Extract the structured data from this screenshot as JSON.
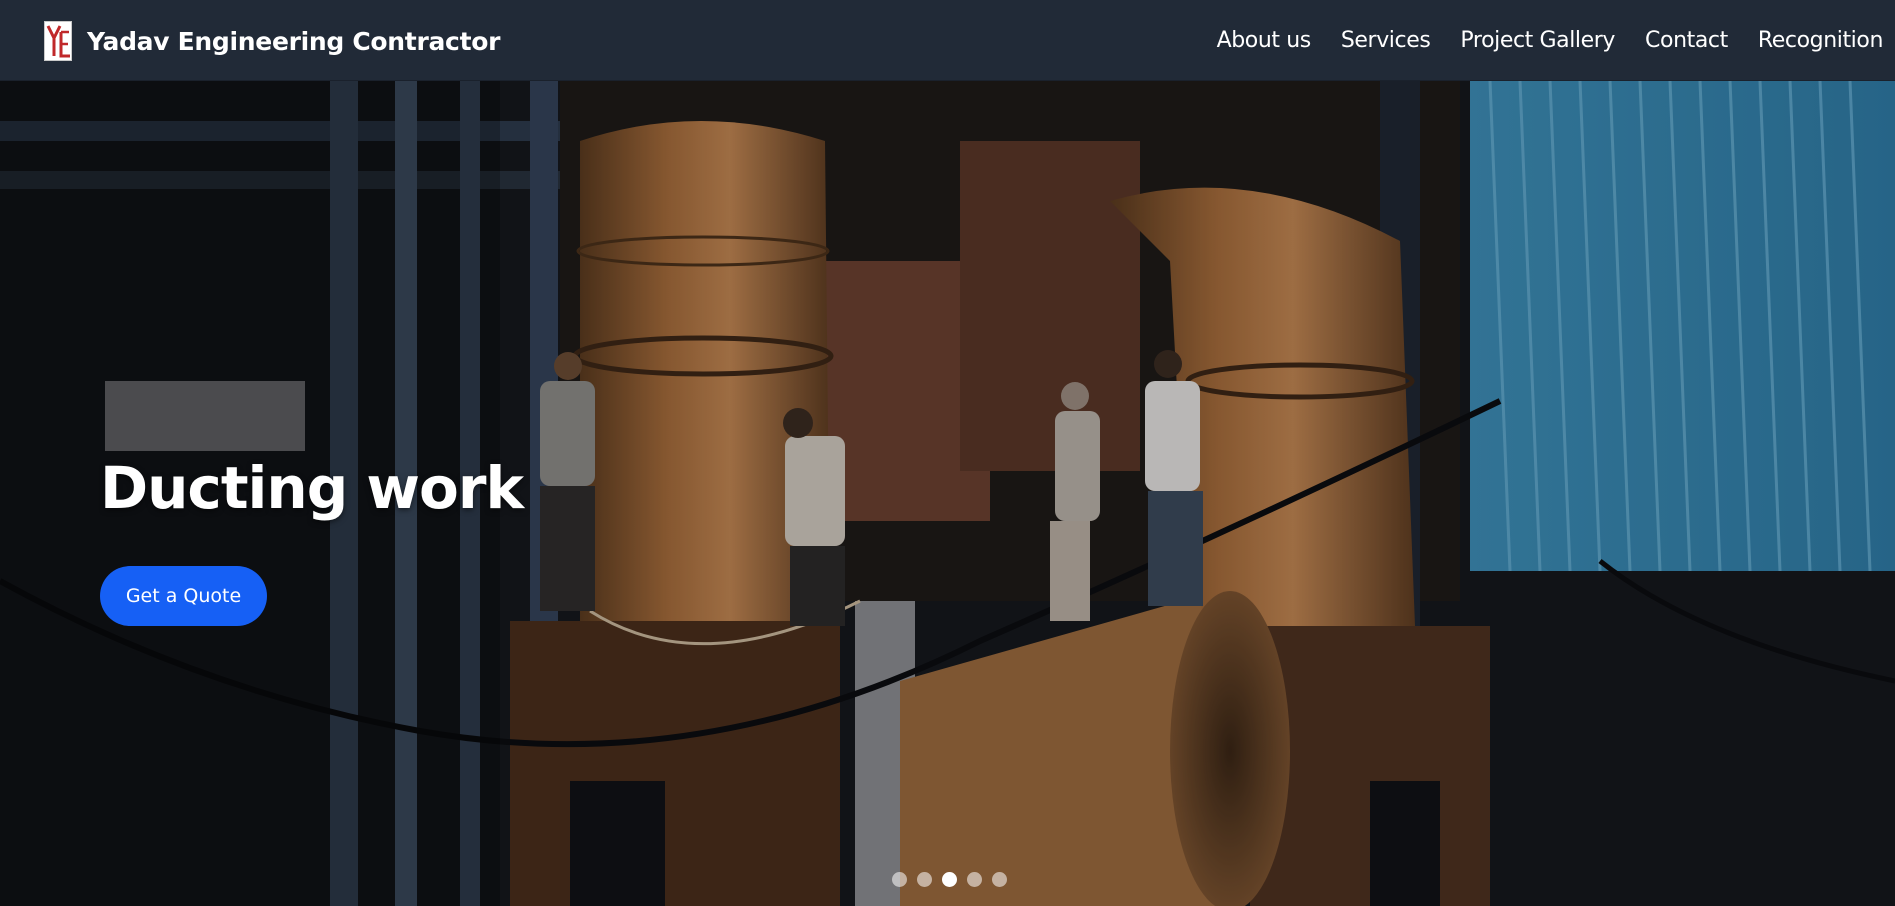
{
  "brand": {
    "name": "Yadav Engineering Contractor",
    "logo_text": "YE",
    "logo_color": "#c0282a"
  },
  "nav": {
    "items": [
      {
        "label": "About us"
      },
      {
        "label": "Services"
      },
      {
        "label": "Project Gallery"
      },
      {
        "label": "Contact"
      },
      {
        "label": "Recognition"
      }
    ]
  },
  "hero": {
    "title": "Ducting work",
    "cta_label": "Get a Quote",
    "slide_count": 5,
    "active_slide": 3,
    "image_subject": "ducting-work-photo"
  },
  "colors": {
    "navbar_bg": "#212a37",
    "cta_bg": "#1660f5",
    "text": "#ffffff"
  }
}
